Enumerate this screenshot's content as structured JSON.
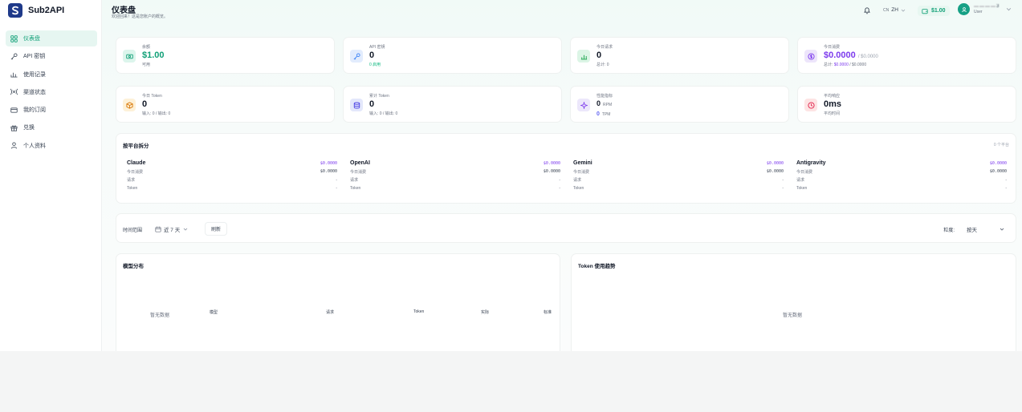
{
  "brand": {
    "name": "Sub2API"
  },
  "sidebar": {
    "items": [
      {
        "label": "仪表盘",
        "icon": "grid-icon",
        "active": true
      },
      {
        "label": "API 密钥",
        "icon": "key-icon",
        "active": false
      },
      {
        "label": "使用记录",
        "icon": "bar-chart-icon",
        "active": false
      },
      {
        "label": "渠道状态",
        "icon": "signal-icon",
        "active": false
      },
      {
        "label": "我的订阅",
        "icon": "card-icon",
        "active": false
      },
      {
        "label": "兑换",
        "icon": "gift-icon",
        "active": false
      },
      {
        "label": "个人资料",
        "icon": "user-icon",
        "active": false
      }
    ]
  },
  "header": {
    "title": "仪表盘",
    "subtitle": "欢迎回来！这是您账户的概览。",
    "lang_code": "CN",
    "lang_label": "ZH",
    "balance": "$1.00",
    "user_role": "User",
    "user_suffix": "3"
  },
  "stats": {
    "balance": {
      "label": "余额",
      "value": "$1.00",
      "sub": "可用"
    },
    "api_keys": {
      "label": "API 密钥",
      "value": "0",
      "sub": "0 启用"
    },
    "today_requests": {
      "label": "今日请求",
      "value": "0",
      "sub": "总计: 0"
    },
    "today_cost": {
      "label": "今日消费",
      "value": "$0.0000",
      "value_suffix": "/ $0.0000",
      "sub_prefix": "总计:",
      "sub_value": "$0.0000",
      "sub_suffix": "/ $0.0000"
    },
    "today_token": {
      "label": "今日 Token",
      "value": "0",
      "sub": "输入: 0 / 输出: 0"
    },
    "total_token": {
      "label": "累计 Token",
      "value": "0",
      "sub": "输入: 0 / 输出: 0"
    },
    "performance": {
      "label": "性能指标",
      "rpm_value": "0",
      "rpm_unit": "RPM",
      "tpm_value": "0",
      "tpm_unit": "TPM"
    },
    "avg_latency": {
      "label": "平均响应",
      "value": "0ms",
      "sub": "平均时间"
    }
  },
  "platforms": {
    "title": "按平台拆分",
    "count": "0 个平台",
    "row_labels": {
      "cost": "今日消费",
      "requests": "请求",
      "token": "Token"
    },
    "items": [
      {
        "name": "Claude",
        "cost": "$0.0000",
        "today_cost": "$0.0000",
        "requests": "-",
        "token": "-"
      },
      {
        "name": "OpenAI",
        "cost": "$0.0000",
        "today_cost": "$0.0000",
        "requests": "-",
        "token": "-"
      },
      {
        "name": "Gemini",
        "cost": "$0.0000",
        "today_cost": "$0.0000",
        "requests": "-",
        "token": "-"
      },
      {
        "name": "Antigravity",
        "cost": "$0.0000",
        "today_cost": "$0.0000",
        "requests": "-",
        "token": "-"
      }
    ]
  },
  "filters": {
    "time_range_label": "时间范围",
    "time_range_value": "近 7 天",
    "refresh_label": "刷新",
    "granularity_label": "粒度:",
    "granularity_value": "按天"
  },
  "model_distribution": {
    "title": "模型分布",
    "empty": "暂无数据",
    "columns": [
      "模型",
      "请求",
      "Token",
      "实际",
      "标准"
    ]
  },
  "token_trend": {
    "title": "Token 使用趋势",
    "empty": "暂无数据"
  },
  "colors": {
    "accent": "#10b981",
    "accent_bg": "#e6f6f1",
    "purple": "#7c3aed"
  }
}
